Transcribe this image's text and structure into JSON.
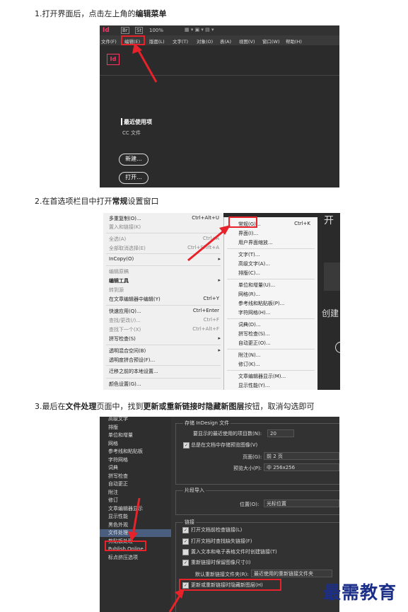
{
  "steps": [
    {
      "pre": "1.打开界面后，点击左上角的",
      "bold": "编辑菜单",
      "post": ""
    },
    {
      "pre": "2.在首选项栏目中打开",
      "bold": "常规",
      "post": "设置窗口"
    },
    {
      "pre": "3.最后在",
      "bold": "文件处理",
      "post": "页面中，找到",
      "bold2": "更新或重新链接时隐藏新图层",
      "post2": "按钮，取消勾选即可"
    }
  ],
  "shot1": {
    "logo": "Id",
    "br": "Br",
    "st": "St",
    "zoom": "100%",
    "menu": [
      "文件(F)",
      "编辑(E)",
      "版面(L)",
      "文字(T)",
      "对象(O)",
      "表(A)",
      "视图(V)",
      "窗口(W)",
      "帮助(H)"
    ],
    "app_icon": "Id",
    "recent_title": "最近使用项",
    "recent_sub": "CC 文件",
    "new_btn": "新建...",
    "open_btn": "打开..."
  },
  "shot2": {
    "left_items": [
      {
        "label": "多重复制(O)...",
        "key": "Ctrl+Alt+U"
      },
      {
        "label": "置入和链接(K)",
        "key": ""
      },
      {
        "label": "全选(A)",
        "key": "Ctrl+A"
      },
      {
        "label": "全部取消选择(E)",
        "key": "Ctrl+Shift+A"
      },
      {
        "label": "InCopy(O)",
        "key": ""
      },
      {
        "label": "编辑原稿",
        "key": ""
      },
      {
        "label": "编辑工具",
        "key": ""
      },
      {
        "label": "转到源",
        "key": ""
      },
      {
        "label": "在文章编辑器中编辑(Y)",
        "key": "Ctrl+Y"
      },
      {
        "label": "快速应用(Q)...",
        "key": "Ctrl+Enter"
      },
      {
        "label": "查找/更改(/)...",
        "key": "Ctrl+F"
      },
      {
        "label": "查找下一个(X)",
        "key": "Ctrl+Alt+F"
      },
      {
        "label": "拼写检查(S)",
        "key": ""
      },
      {
        "label": "透明混合空间(B)",
        "key": ""
      },
      {
        "label": "透明度拼合预设(F)...",
        "key": ""
      },
      {
        "label": "迁移之前的本地设置...",
        "key": ""
      },
      {
        "label": "颜色设置(G)...",
        "key": ""
      }
    ],
    "right_items": [
      {
        "label": "常规(G)...",
        "key": "Ctrl+K"
      },
      {
        "label": "界面(I)...",
        "key": ""
      },
      {
        "label": "用户界面缩放...",
        "key": ""
      },
      {
        "label": "文字(T)...",
        "key": ""
      },
      {
        "label": "高级文字(A)...",
        "key": ""
      },
      {
        "label": "排版(C)...",
        "key": ""
      },
      {
        "label": "单位和增量(U)...",
        "key": ""
      },
      {
        "label": "网格(R)...",
        "key": ""
      },
      {
        "label": "参考线和粘贴板(P)...",
        "key": ""
      },
      {
        "label": "字符网格(H)...",
        "key": ""
      },
      {
        "label": "词典(D)...",
        "key": ""
      },
      {
        "label": "拼写检查(S)...",
        "key": ""
      },
      {
        "label": "自动更正(O)...",
        "key": ""
      },
      {
        "label": "附注(N)...",
        "key": ""
      },
      {
        "label": "修订(K)...",
        "key": ""
      },
      {
        "label": "文章编辑器显示(M)...",
        "key": ""
      },
      {
        "label": "显示性能(Y)...",
        "key": ""
      }
    ],
    "bg_text_1": "开",
    "bg_text_2": "创建"
  },
  "shot3": {
    "sidebar": [
      "高级文字",
      "排版",
      "单位和增量",
      "网格",
      "参考线和粘贴板",
      "字符网格",
      "词典",
      "拼写检查",
      "自动更正",
      "附注",
      "修订",
      "文章编辑器显示",
      "显示性能",
      "黑色外观",
      "文件处理",
      "剪贴板处理",
      "Publish Online",
      "标点挤压选项"
    ],
    "selected": "文件处理",
    "section1_title": "存储 InDesign 文件",
    "recent_files_label": "要显示的最近使用的项目数(N):",
    "recent_files_value": "20",
    "preview_label": "总是在文档中存储预览图像(V)",
    "page_label": "页面(G):",
    "page_value": "前 2 页",
    "preview_size_label": "预览大小(P):",
    "preview_size_value": "中 256x256",
    "section2_title": "片段导入",
    "position_label": "位置(O):",
    "position_value": "光标位置",
    "section3_title": "链接",
    "cb1": "打开文档前检查链接(L)",
    "cb2": "打开文档时查找缺失链接(F)",
    "cb3": "置入文本和电子表格文件时创建链接(T)",
    "cb4": "重新链接时保留图像尺寸(I)",
    "default_relink_label": "默认重新链接文件夹(R):",
    "default_relink_value": "最近使用的重新链接文件夹",
    "cb5": "更新或重新链接时隐藏新图层(H)"
  },
  "watermark": "最需教育",
  "colors": {
    "accent_red": "#e8222a",
    "dark_bg": "#2b2b2b",
    "id_pink": "#ff3366",
    "watermark": "#1c2f88"
  }
}
